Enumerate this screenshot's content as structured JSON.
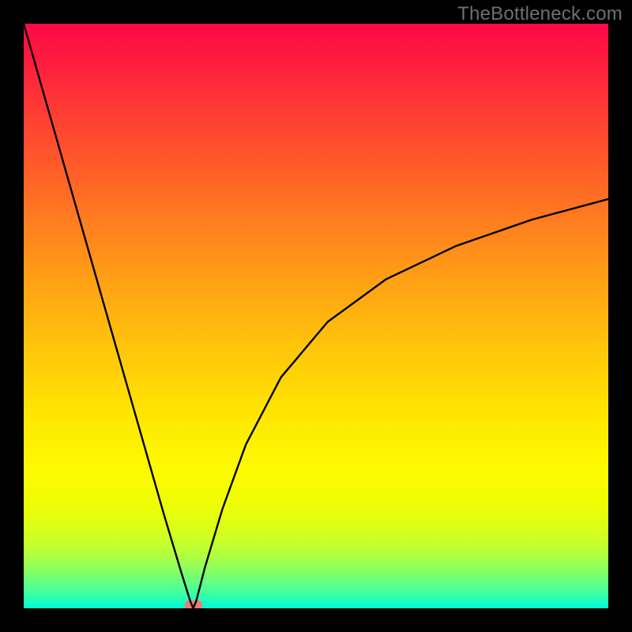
{
  "watermark": "TheBottleneck.com",
  "chart_data": {
    "type": "line",
    "title": "",
    "xlabel": "",
    "ylabel": "",
    "xlim": [
      0,
      1
    ],
    "ylim": [
      0,
      1
    ],
    "note": "Axes are unlabeled in the source image; values are normalized estimates read from the plot geometry. The curve has a sharp cusp/minimum near x≈0.29, y≈0 and rises asymptotically toward ~0.7 on the right.",
    "series": [
      {
        "name": "curve",
        "x": [
          0.0,
          0.05,
          0.1,
          0.15,
          0.2,
          0.24,
          0.27,
          0.285,
          0.29,
          0.295,
          0.31,
          0.34,
          0.38,
          0.44,
          0.52,
          0.62,
          0.74,
          0.87,
          1.0
        ],
        "y": [
          1.0,
          0.825,
          0.65,
          0.475,
          0.3,
          0.16,
          0.06,
          0.012,
          0.0,
          0.012,
          0.07,
          0.17,
          0.28,
          0.395,
          0.49,
          0.563,
          0.62,
          0.665,
          0.7
        ]
      }
    ],
    "vertex": {
      "x": 0.29,
      "y": 0.0
    },
    "colors": {
      "curve": "#000000",
      "background_top": "#fb0947",
      "background_bottom": "#03f6d6",
      "frame": "#000000",
      "vertex_marker": "#ec7b78"
    }
  }
}
